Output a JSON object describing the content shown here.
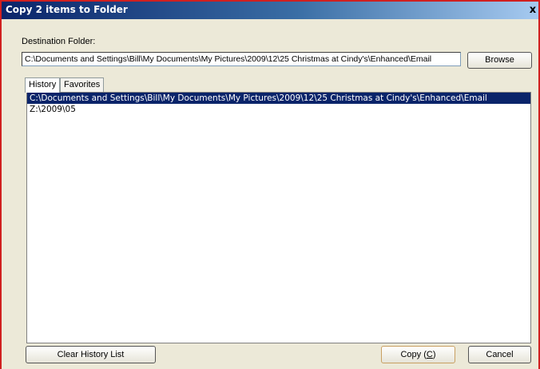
{
  "window": {
    "title": "Copy 2 items to Folder",
    "close_label": "x"
  },
  "destination": {
    "label": "Destination Folder:",
    "value": "C:\\Documents and Settings\\Bill\\My Documents\\My Pictures\\2009\\12\\25 Christmas at Cindy's\\Enhanced\\Email",
    "browse_label": "Browse"
  },
  "tabs": [
    {
      "label": "History",
      "active": true
    },
    {
      "label": "Favorites",
      "active": false
    }
  ],
  "history_list": [
    {
      "path": "C:\\Documents and Settings\\Bill\\My Documents\\My Pictures\\2009\\12\\25 Christmas at Cindy's\\Enhanced\\Email",
      "selected": true
    },
    {
      "path": "Z:\\2009\\05",
      "selected": false
    }
  ],
  "buttons": {
    "clear_history": "Clear History List",
    "copy_prefix": "Copy (",
    "copy_hotkey": "C",
    "copy_suffix": ")",
    "cancel": "Cancel"
  },
  "colors": {
    "title_gradient_start": "#0a246a",
    "title_gradient_end": "#a6caf0",
    "selection": "#0a246a",
    "dialog_bg": "#ece9d8",
    "window_border": "#d02020"
  }
}
